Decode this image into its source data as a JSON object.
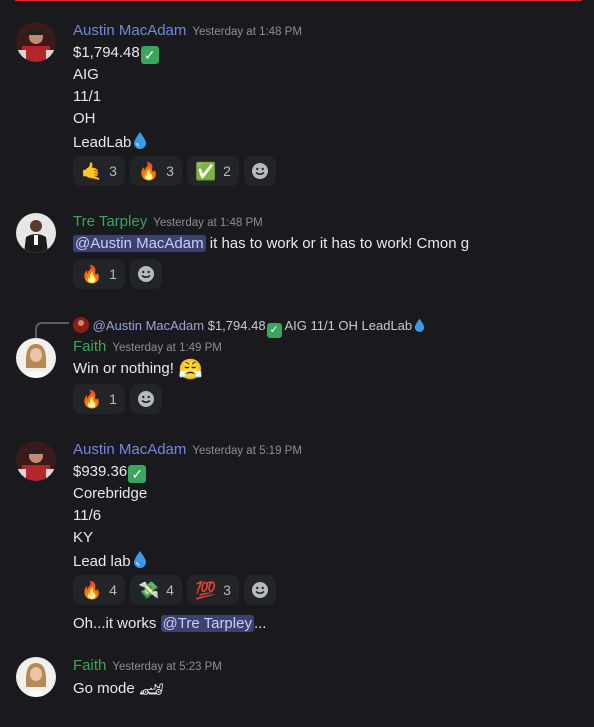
{
  "colors": {
    "background": "#1a1a1e",
    "austin_name": "#7289da",
    "green_name": "#3ba55c",
    "mention_bg": "#3c4270",
    "divider": "#e0242f"
  },
  "messages": [
    {
      "author": "Austin MacAdam",
      "timestamp": "Yesterday at 1:48 PM",
      "lines": [
        "$1,794.48",
        "AIG",
        "11/1",
        "OH",
        "LeadLab"
      ],
      "reactions": [
        {
          "emoji": "🤙",
          "count": "3"
        },
        {
          "emoji": "🔥",
          "count": "3"
        },
        {
          "emoji": "✅",
          "count": "2"
        }
      ]
    },
    {
      "author": "Tre Tarpley",
      "timestamp": "Yesterday at 1:48 PM",
      "mention": "@Austin MacAdam",
      "text": " it has to work or it has to work! Cmon g",
      "reactions": [
        {
          "emoji": "🔥",
          "count": "1"
        }
      ]
    },
    {
      "reply_mention": "@Austin MacAdam",
      "reply_text": "$1,794.48",
      "reply_rest": " AIG 11/1 OH LeadLab",
      "author": "Faith",
      "timestamp": "Yesterday at 1:49 PM",
      "text": "Win or nothing! ",
      "emoji": "😤",
      "reactions": [
        {
          "emoji": "🔥",
          "count": "1"
        }
      ]
    },
    {
      "author": "Austin MacAdam",
      "timestamp": "Yesterday at 5:19 PM",
      "lines": [
        "$939.36",
        "Corebridge",
        "11/6",
        "KY",
        "Lead lab"
      ],
      "reactions": [
        {
          "emoji": "🔥",
          "count": "4"
        },
        {
          "emoji": "💸",
          "count": "4"
        },
        {
          "emoji": "💯",
          "count": "3"
        }
      ],
      "followup_prefix": "Oh...it works ",
      "followup_mention": "@Tre Tarpley",
      "followup_suffix": "..."
    },
    {
      "author": "Faith",
      "timestamp": "Yesterday at 5:23 PM",
      "text": "Go mode ",
      "emoji": "🏎"
    }
  ]
}
